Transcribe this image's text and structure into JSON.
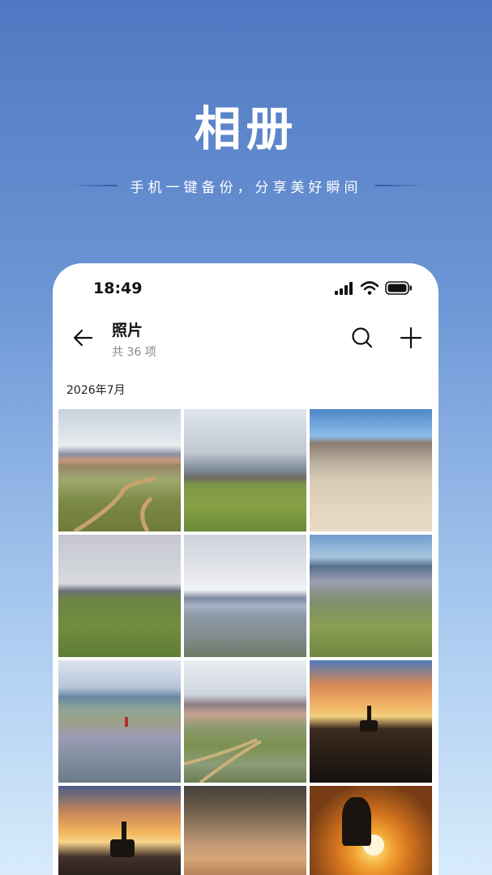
{
  "hero": {
    "title": "相册",
    "subtitle": "手机一键备份，分享美好瞬间"
  },
  "status_bar": {
    "time": "18:49",
    "icons": [
      "signal-icon",
      "wifi-icon",
      "battery-icon"
    ]
  },
  "app_bar": {
    "title": "照片",
    "count": "共 36 项",
    "icons": [
      "back-arrow-icon",
      "search-icon",
      "add-icon"
    ]
  },
  "section": {
    "date": "2026年7月"
  },
  "photos": [
    {
      "id": "photo-1",
      "scene": "mountains-grassland-tracks"
    },
    {
      "id": "photo-2",
      "scene": "cloudy-sky-grassland"
    },
    {
      "id": "photo-3",
      "scene": "desert-dunes"
    },
    {
      "id": "photo-4",
      "scene": "overcast-grassland"
    },
    {
      "id": "photo-5",
      "scene": "snow-mountains-flower-field"
    },
    {
      "id": "photo-6",
      "scene": "flower-meadow"
    },
    {
      "id": "photo-7",
      "scene": "meadow-person"
    },
    {
      "id": "photo-8",
      "scene": "mountains-meadow-tracks"
    },
    {
      "id": "photo-9",
      "scene": "sunset-silhouette-car"
    },
    {
      "id": "photo-10",
      "scene": "sunset-person-on-car"
    },
    {
      "id": "photo-11",
      "scene": "desert-riders-poster"
    },
    {
      "id": "photo-12",
      "scene": "sunset-couple-silhouette"
    }
  ],
  "colors": {
    "background_top": "#4f78c2",
    "background_bottom": "#d7ebfb",
    "card_bg": "#ffffff",
    "text_primary": "#111111",
    "text_secondary": "#888888"
  }
}
